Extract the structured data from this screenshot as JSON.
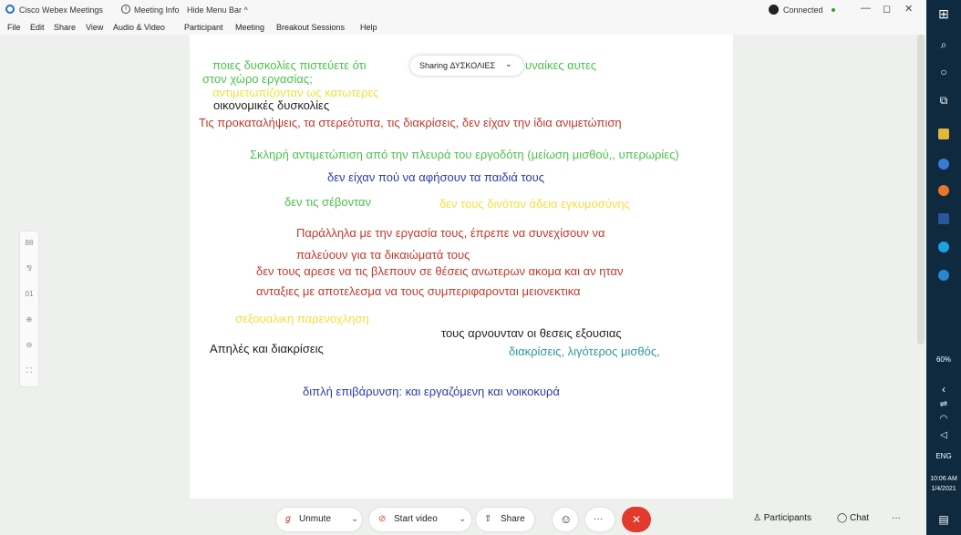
{
  "titlebar": {
    "app_name": "Cisco Webex Meetings",
    "meeting_info": "Meeting Info",
    "hide_menu": "Hide Menu Bar ^",
    "connection": "Connected",
    "minimize": "—",
    "maximize": "◻",
    "close": "✕"
  },
  "menu": [
    "File",
    "Edit",
    "Share",
    "View",
    "Audio & Video",
    "Participant",
    "Meeting",
    "Breakout Sessions",
    "Help"
  ],
  "share_pill": {
    "label": "Sharing ΔΥΣΚΟΛΙΕΣ",
    "chevron": "⌄"
  },
  "slide": {
    "lines": [
      {
        "text": "ποιες δυσκολίες πιστεύετε ότι",
        "color": "#4cc24c"
      },
      {
        "text": "υναίκες αυτες",
        "color": "#4cc24c"
      },
      {
        "text": "στον χώρο εργασίας;",
        "color": "#4cc24c"
      },
      {
        "text": "αντιμετωπίζονταν ως κατωτερες",
        "color": "#f0e042"
      },
      {
        "text": "οικονομικές δυσκολίες",
        "color": "#222222"
      },
      {
        "text": "Τις προκαταλήψεις, τα στερεότυπα, τις διακρίσεις, δεν είχαν την ίδια ανιμετώπιση",
        "color": "#c0392b"
      },
      {
        "text": "Σκληρή αντιμετώπιση από την πλευρά του εργοδότη (μείωση μισθού,, υπερωρίες)",
        "color": "#4cc24c"
      },
      {
        "text": "δεν είχαν πού να αφήσουν τα παιδιά τους",
        "color": "#2e3aa8"
      },
      {
        "text": "δεν τις σέβονταν",
        "color": "#4cc24c"
      },
      {
        "text": "δεν τους δινόταν άδεια εγκυμοσύνης",
        "color": "#f0e042"
      },
      {
        "text": "Παράλληλα με την εργασία τους, έπρεπε να συνεχίσουν να",
        "color": "#c0392b"
      },
      {
        "text": "παλεύουν για τα δικαιώματά τους",
        "color": "#c0392b"
      },
      {
        "text": "δεν τους αρεσε να τις βλεπουν σε θέσεις ανωτερων ακομα και αν ηταν",
        "color": "#c0392b"
      },
      {
        "text": "ανταξιες με αποτελεσμα να τους συμπεριφαρονται μειονεκτικα",
        "color": "#c0392b"
      },
      {
        "text": "σεξουαλικη παρενοχληση",
        "color": "#f0e042"
      },
      {
        "text": "τους αρνουνταν οι θεσεις εξουσιας",
        "color": "#222222"
      },
      {
        "text": "Απηλές και διακρίσεις",
        "color": "#222222"
      },
      {
        "text": "διακρίσεις, λιγότερος μισθός,",
        "color": "#2a9a9a"
      },
      {
        "text": "διπλή επιβάρυνση: και εργαζόμενη και νοικοκυρά",
        "color": "#2e3aa8"
      }
    ]
  },
  "side_tools": [
    "88",
    "⅋",
    "01",
    "⊕",
    "⊖",
    "⛶"
  ],
  "controls": {
    "unmute": "Unmute",
    "start_video": "Start video",
    "share": "Share",
    "reactions": "☺",
    "more": "···",
    "leave": "✕",
    "participants": "Participants",
    "chat": "Chat",
    "more_right": "···"
  },
  "taskbar": {
    "battery": "60%",
    "language": "ENG",
    "time": "10:06 AM",
    "date": "1/4/2021"
  }
}
